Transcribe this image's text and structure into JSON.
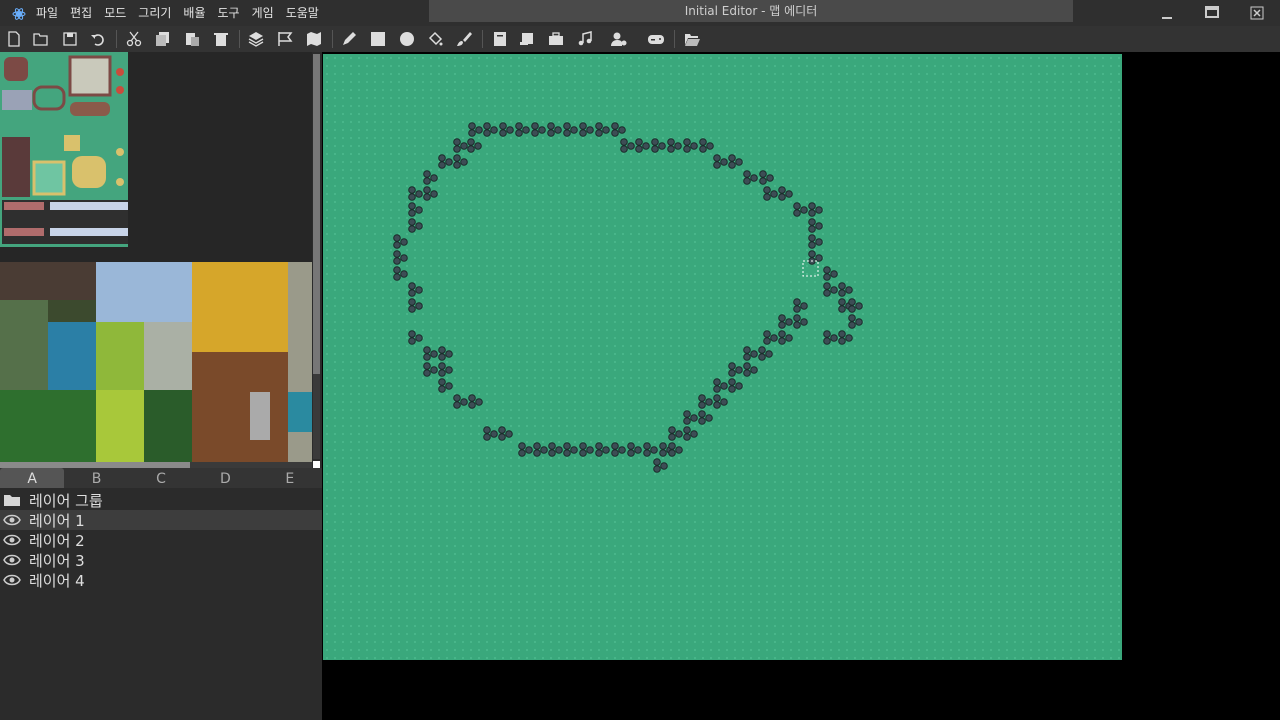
{
  "window": {
    "title": "Initial Editor - 맵 에디터",
    "menu": [
      "파일",
      "편집",
      "모드",
      "그리기",
      "배율",
      "도구",
      "게임",
      "도움말"
    ]
  },
  "toolbar": {
    "icons": [
      "new-file",
      "open-folder",
      "save",
      "undo",
      "cut",
      "copy",
      "paste",
      "delete",
      "layers",
      "flag",
      "map",
      "pencil",
      "rectangle",
      "circle",
      "fill",
      "brush",
      "book",
      "scroll",
      "toolbox",
      "music",
      "user-settings",
      "gamepad",
      "folder-open"
    ]
  },
  "tileset": {
    "tabs": [
      "A",
      "B",
      "C",
      "D",
      "E"
    ],
    "active_tab": "A"
  },
  "layers": {
    "group": "레이어 그룹",
    "items": [
      "레이어 1",
      "레이어 2",
      "레이어 3",
      "레이어 4"
    ],
    "selected": "레이어 1"
  },
  "colors": {
    "map_grass": "#3aa87c",
    "panel_bg": "#2b2b2b"
  }
}
